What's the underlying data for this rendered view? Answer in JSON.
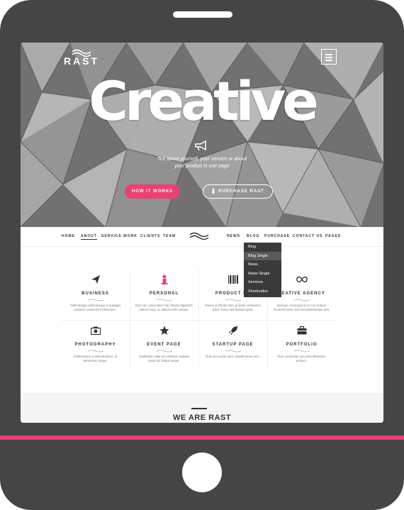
{
  "hero": {
    "logo_text": "RAST",
    "headline": "Creative",
    "tagline_line1": "Tell about yourself, your service or about",
    "tagline_line2": "your product in one page",
    "btn_how": "HOW IT WORKS",
    "btn_purchase": "PURCHASE RAST"
  },
  "nav": {
    "home": "HOME",
    "about": "ABOUT",
    "service": "SERVICE",
    "work": "WORK",
    "clients": "CLIENTS",
    "team": "TEAM",
    "news": "NEWS",
    "blog": "BLOG",
    "purchase": "PURCHASE",
    "contact": "CONTACT US",
    "pages": "PAGES"
  },
  "dropdown": {
    "items": [
      "Blog",
      "Blog Single",
      "News",
      "News Single",
      "Services",
      "Shortcodes"
    ],
    "highlighted": "Blog Single"
  },
  "features": [
    {
      "icon": "paper-plane-icon",
      "title": "BUSINESS",
      "desc": "Pellentesque pellentesque in duisaget posuere consectetur bibendum."
    },
    {
      "icon": "person-icon",
      "title": "PERSONAL",
      "desc": "Duis nac consectetur erat. Mauris dignissim ultrices risus, ac ultricies felis semper."
    },
    {
      "icon": "barcode-icon",
      "title": "PRODUCT PA",
      "desc": "Mauris id efficitur sem, pulvinar vestibulum dolor. Fusce sed facilisis ligula."
    },
    {
      "icon": "infinity-icon",
      "title": "REATIVE AGENCY",
      "desc": "Quisque consequat ut ex non semper hendrerit porta. Sed sed pellentesque erat."
    },
    {
      "icon": "camera-icon",
      "title": "PHOTOGRAPHY",
      "desc": "Pellentesque a vehicula libero, id fermentum neque."
    },
    {
      "icon": "star-icon",
      "title": "EVENT PAGE",
      "desc": "Vestibulum vitae orci eleifend, sodales ipsum id, finibus neque."
    },
    {
      "icon": "rocket-icon",
      "title": "STARTUP PAGE",
      "desc": "Duis non auctor nunc, blandit porta nunc."
    },
    {
      "icon": "briefcase-icon",
      "title": "PORTFOLIO",
      "desc": "Nunc accumsan non enim bibendum pretium."
    }
  ],
  "section": {
    "title": "WE ARE RAST"
  },
  "colors": {
    "accent": "#ec3f74",
    "device": "#454545",
    "dropdown": "#3a3a3a"
  }
}
